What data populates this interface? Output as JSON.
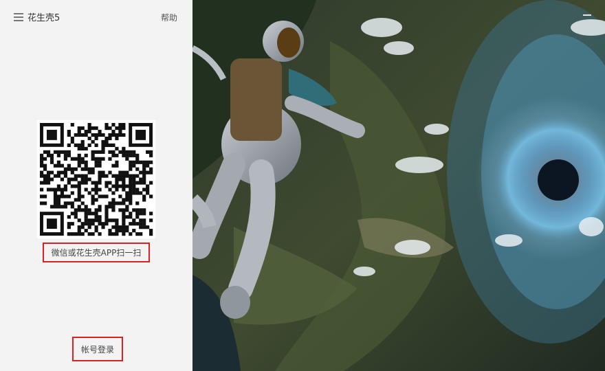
{
  "header": {
    "app_title": "花生壳5",
    "help_label": "帮助",
    "menu_icon": "hamburger-menu-icon",
    "minimize_icon": "minimize-icon"
  },
  "login": {
    "qr_code": "qr-code-image",
    "scan_tip": "微信或花生壳APP扫一扫",
    "account_login_label": "帐号登录"
  },
  "colors": {
    "panel_bg": "#f3f3f3",
    "highlight_border": "#e02020"
  },
  "banner": {
    "image": "astronaut-falling-into-vortex-landscape"
  }
}
